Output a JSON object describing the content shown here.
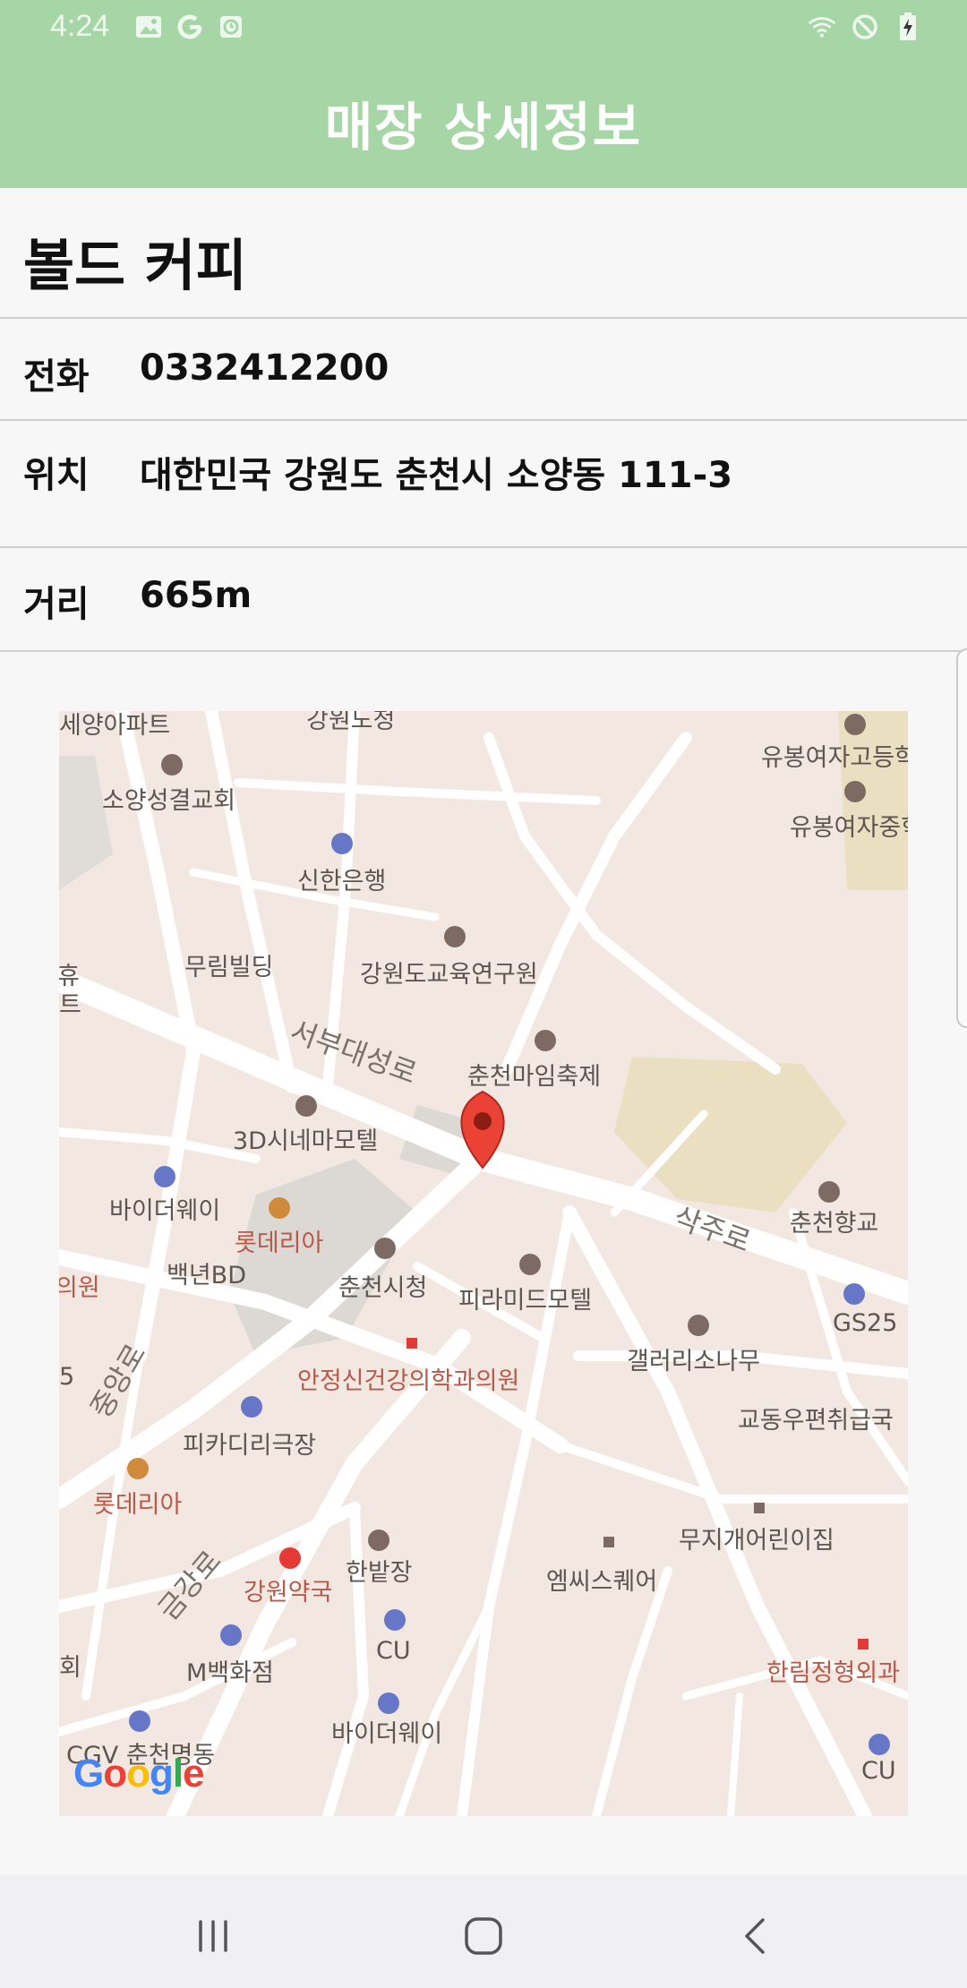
{
  "status_bar": {
    "time": "4:24"
  },
  "app_bar": {
    "title": "매장 상세정보"
  },
  "store": {
    "name": "볼드 커피",
    "phone_label": "전화",
    "phone": "0332412200",
    "location_label": "위치",
    "location": "대한민국 강원도 춘천시 소양동 111-3",
    "distance_label": "거리",
    "distance": "665m"
  },
  "map": {
    "attribution": "Google",
    "labels": [
      "세양아파트",
      "강원도청",
      "유봉여자고등학교",
      "소양성결교회",
      "유봉여자중학교",
      "신한은행",
      "무림빌딩",
      "강원도교육연구원",
      "서부대성로",
      "춘천마임축제",
      "3D시네마모텔",
      "바이더웨이",
      "롯데리아",
      "춘천향교",
      "삭주로",
      "백년BD",
      "춘천시청",
      "피라미드모텔",
      "GS25",
      "의원",
      "갤러리소나무",
      "안정신건강의학과의원",
      "교동우편취급국",
      "중앙로",
      "피카디리극장",
      "롯데리아",
      "무지개어린이집",
      "금강로",
      "한밭장",
      "엠씨스퀘어",
      "강원약국",
      "CU",
      "M백화점",
      "한림정형외과",
      "바이더웨이",
      "CGV 춘천명동",
      "CU",
      "휴",
      "트",
      "5",
      "회"
    ]
  },
  "colors": {
    "accent": "#a6d6a5",
    "map_bg": "#f3e8e1",
    "marker": "#ea4335"
  }
}
